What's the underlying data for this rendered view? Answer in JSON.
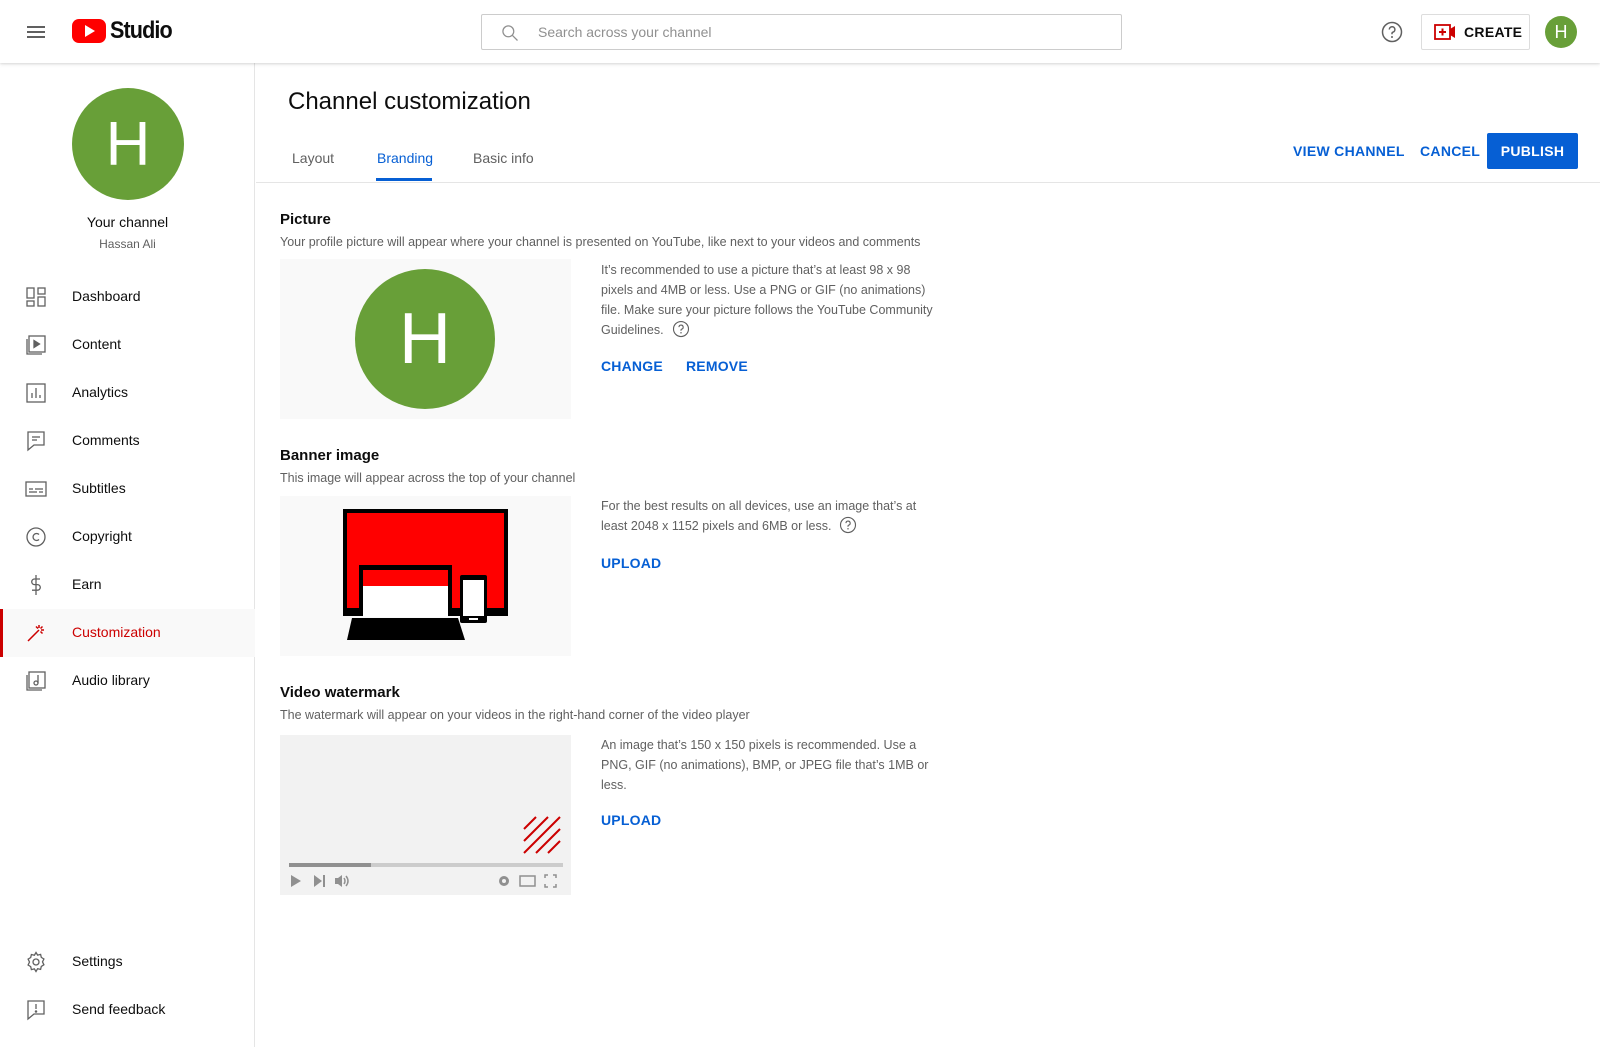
{
  "header": {
    "logo_text": "Studio",
    "search_placeholder": "Search across your channel",
    "create_label": "CREATE",
    "avatar_letter": "H"
  },
  "sidebar": {
    "avatar_letter": "H",
    "your_channel": "Your channel",
    "channel_name": "Hassan Ali",
    "items": [
      {
        "label": "Dashboard",
        "icon": "dashboard-icon"
      },
      {
        "label": "Content",
        "icon": "content-icon"
      },
      {
        "label": "Analytics",
        "icon": "analytics-icon"
      },
      {
        "label": "Comments",
        "icon": "comments-icon"
      },
      {
        "label": "Subtitles",
        "icon": "subtitles-icon"
      },
      {
        "label": "Copyright",
        "icon": "copyright-icon"
      },
      {
        "label": "Earn",
        "icon": "earn-icon"
      },
      {
        "label": "Customization",
        "icon": "customization-icon",
        "active": true
      },
      {
        "label": "Audio library",
        "icon": "audio-library-icon"
      }
    ],
    "bottom_items": [
      {
        "label": "Settings",
        "icon": "settings-icon"
      },
      {
        "label": "Send feedback",
        "icon": "feedback-icon"
      }
    ]
  },
  "main": {
    "title": "Channel customization",
    "tabs": [
      {
        "label": "Layout"
      },
      {
        "label": "Branding",
        "active": true
      },
      {
        "label": "Basic info"
      }
    ],
    "actions": {
      "view_channel": "VIEW CHANNEL",
      "cancel": "CANCEL",
      "publish": "PUBLISH"
    },
    "picture": {
      "title": "Picture",
      "description": "Your profile picture will appear where your channel is presented on YouTube, like next to your videos and comments",
      "avatar_letter": "H",
      "info": "It’s recommended to use a picture that’s at least 98 x 98 pixels and 4MB or less. Use a PNG or GIF (no animations) file. Make sure your picture follows the YouTube Community Guidelines.",
      "change": "CHANGE",
      "remove": "REMOVE"
    },
    "banner": {
      "title": "Banner image",
      "description": "This image will appear across the top of your channel",
      "info": "For the best results on all devices, use an image that’s at least 2048 x 1152 pixels and 6MB or less.",
      "upload": "UPLOAD"
    },
    "watermark": {
      "title": "Video watermark",
      "description": "The watermark will appear on your videos in the right-hand corner of the video player",
      "info": "An image that’s 150 x 150 pixels is recommended. Use a PNG, GIF (no animations), BMP, or JPEG file that’s 1MB or less.",
      "upload": "UPLOAD",
      "progress": 0.3
    }
  },
  "colors": {
    "brand_red": "#ff0000",
    "accent_blue": "#065fd4",
    "avatar_green": "#689f38",
    "active_red": "#cc0000"
  }
}
